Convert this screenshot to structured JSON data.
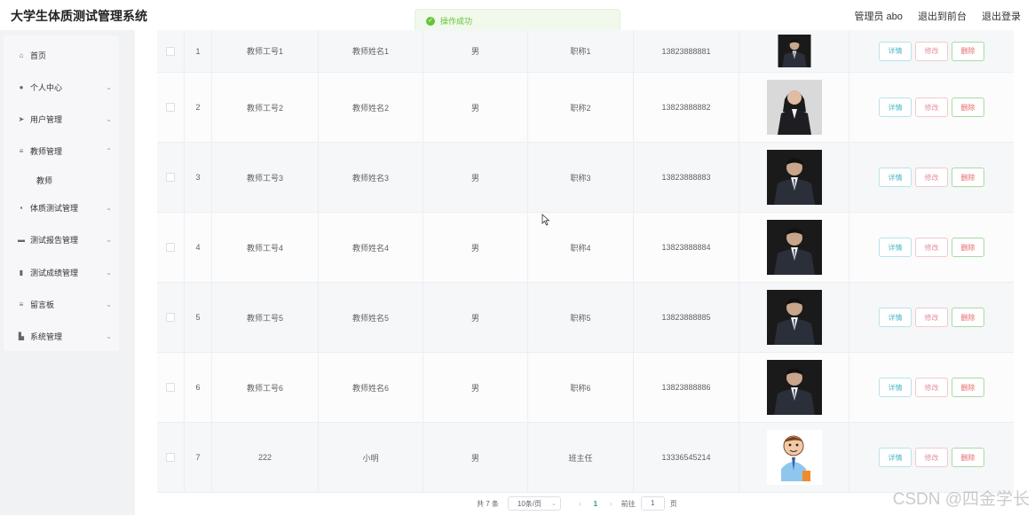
{
  "app": {
    "title": "大学生体质测试管理系统"
  },
  "header": {
    "user_label": "管理员 abo",
    "to_front": "退出到前台",
    "logout": "退出登录"
  },
  "toast": {
    "message": "操作成功"
  },
  "sidebar": {
    "items": [
      {
        "label": "首页",
        "icon": "home-icon"
      },
      {
        "label": "个人中心",
        "icon": "user-icon"
      },
      {
        "label": "用户管理",
        "icon": "send-icon"
      },
      {
        "label": "教师管理",
        "icon": "list-icon"
      },
      {
        "label": "体质测试管理",
        "icon": "grid-icon"
      },
      {
        "label": "测试报告管理",
        "icon": "monitor-icon"
      },
      {
        "label": "测试成绩管理",
        "icon": "clipboard-icon"
      },
      {
        "label": "留言板",
        "icon": "list-icon"
      },
      {
        "label": "系统管理",
        "icon": "chart-icon"
      }
    ],
    "submenu_label": "教师"
  },
  "table": {
    "rows": [
      {
        "index": "1",
        "no": "教师工号1",
        "name": "教师姓名1",
        "sex": "男",
        "title": "职称1",
        "phone": "13823888881",
        "photo": "man-photo"
      },
      {
        "index": "2",
        "no": "教师工号2",
        "name": "教师姓名2",
        "sex": "男",
        "title": "职称2",
        "phone": "13823888882",
        "photo": "woman-photo"
      },
      {
        "index": "3",
        "no": "教师工号3",
        "name": "教师姓名3",
        "sex": "男",
        "title": "职称3",
        "phone": "13823888883",
        "photo": "man-photo"
      },
      {
        "index": "4",
        "no": "教师工号4",
        "name": "教师姓名4",
        "sex": "男",
        "title": "职称4",
        "phone": "13823888884",
        "photo": "man-photo"
      },
      {
        "index": "5",
        "no": "教师工号5",
        "name": "教师姓名5",
        "sex": "男",
        "title": "职称5",
        "phone": "13823888885",
        "photo": "man-photo"
      },
      {
        "index": "6",
        "no": "教师工号6",
        "name": "教师姓名6",
        "sex": "男",
        "title": "职称6",
        "phone": "13823888886",
        "photo": "man-photo"
      },
      {
        "index": "7",
        "no": "222",
        "name": "小明",
        "sex": "男",
        "title": "班主任",
        "phone": "13336545214",
        "photo": "cartoon-photo"
      }
    ],
    "actions": {
      "detail": "详情",
      "edit": "修改",
      "delete": "删除"
    }
  },
  "pagination": {
    "total": "共 7 条",
    "page_size": "10条/页",
    "current": "1",
    "goto_label": "前往",
    "goto_value": "1",
    "page_suffix": "页"
  },
  "watermark": "CSDN @四金学长",
  "colors": {
    "success": "#67c23a",
    "pager_active": "#1fa05a"
  }
}
